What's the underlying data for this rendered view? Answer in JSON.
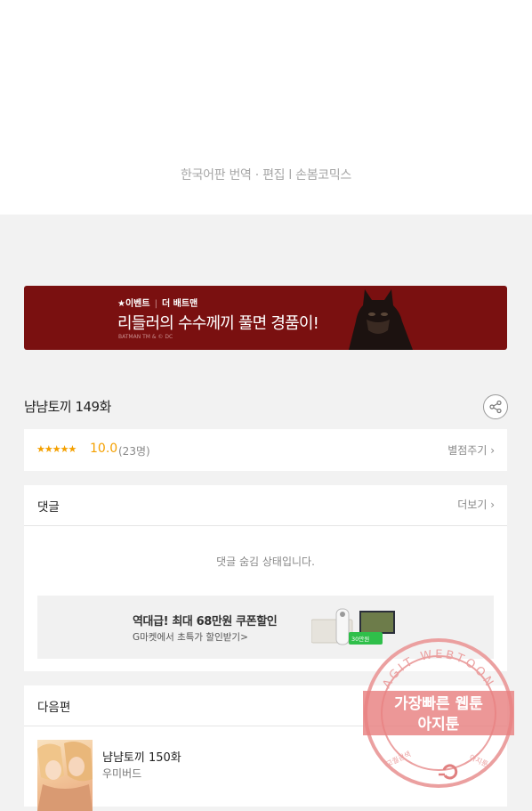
{
  "credits": "한국어판 번역 · 편집  l  손봄코믹스",
  "banner": {
    "tag_event": "★이벤트",
    "tag_title": "더 배트맨",
    "headline": "리들러의 수수께끼 풀면 경품이!",
    "copyright": "BATMAN TM & © DC"
  },
  "episode": {
    "title": "냠냠토끼 149화"
  },
  "rating": {
    "stars": "★★★★★",
    "score": "10.0",
    "count": "(23명)",
    "rate_label": "별점주기 ›"
  },
  "comments": {
    "header": "댓글",
    "more": "더보기 ›",
    "hidden_message": "댓글 숨김 상태입니다."
  },
  "ad": {
    "title": "역대급! 최대 68만원 쿠폰할인",
    "subtitle": "G마켓에서 초특가 할인받기>",
    "badge": "30만원"
  },
  "next": {
    "header": "다음편",
    "title": "냠냠토끼 150화",
    "author": "우미버드"
  },
  "stamp": {
    "ring_text": "AGIT WEBTOON",
    "line1": "가장빠른 웹툰",
    "line2": "아지툰",
    "bottom_left": "고퀄검색",
    "bottom_right": "아지툰"
  },
  "colors": {
    "banner_bg": "#7a1010",
    "accent_star": "#f4a000",
    "page_bg": "#f2f2f2"
  }
}
